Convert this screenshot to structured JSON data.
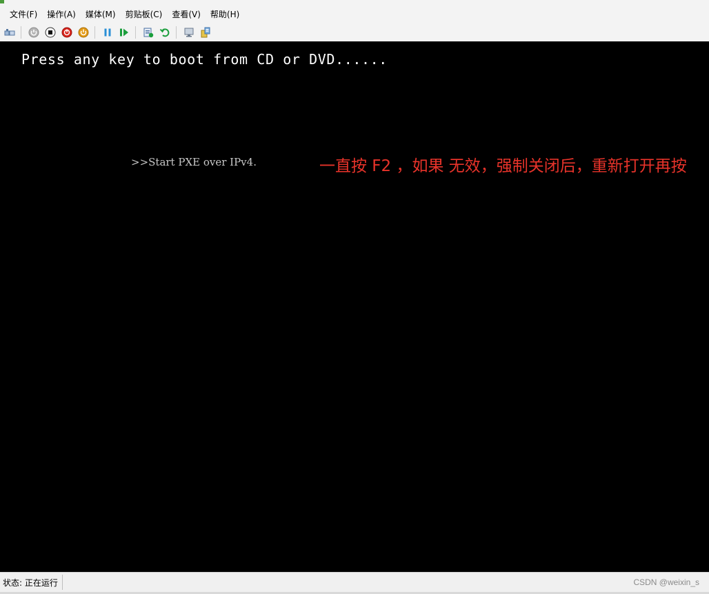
{
  "menubar": {
    "items": [
      {
        "label": "文件(F)"
      },
      {
        "label": "操作(A)"
      },
      {
        "label": "媒体(M)"
      },
      {
        "label": "剪贴板(C)"
      },
      {
        "label": "查看(V)"
      },
      {
        "label": "帮助(H)"
      }
    ]
  },
  "toolbar": {
    "buttons": [
      {
        "icon": "ctrl-alt-del-icon"
      },
      {
        "icon": "start-icon"
      },
      {
        "icon": "turn-off-icon"
      },
      {
        "icon": "shutdown-icon"
      },
      {
        "icon": "power-icon"
      },
      {
        "icon": "pause-icon"
      },
      {
        "icon": "resume-icon"
      },
      {
        "icon": "checkpoint-icon"
      },
      {
        "icon": "revert-icon"
      },
      {
        "icon": "enhanced-session-icon"
      },
      {
        "icon": "share-icon"
      }
    ]
  },
  "screen": {
    "boot_prompt": "Press any key to boot from CD or DVD......",
    "pxe_message": ">>Start PXE over IPv4.",
    "annotation": "一直按 F2 ，如果 无效，强制关闭后，重新打开再按",
    "annotation_color": "#e8332a"
  },
  "statusbar": {
    "status": "状态: 正在运行",
    "watermark": "CSDN @weixin_s"
  }
}
